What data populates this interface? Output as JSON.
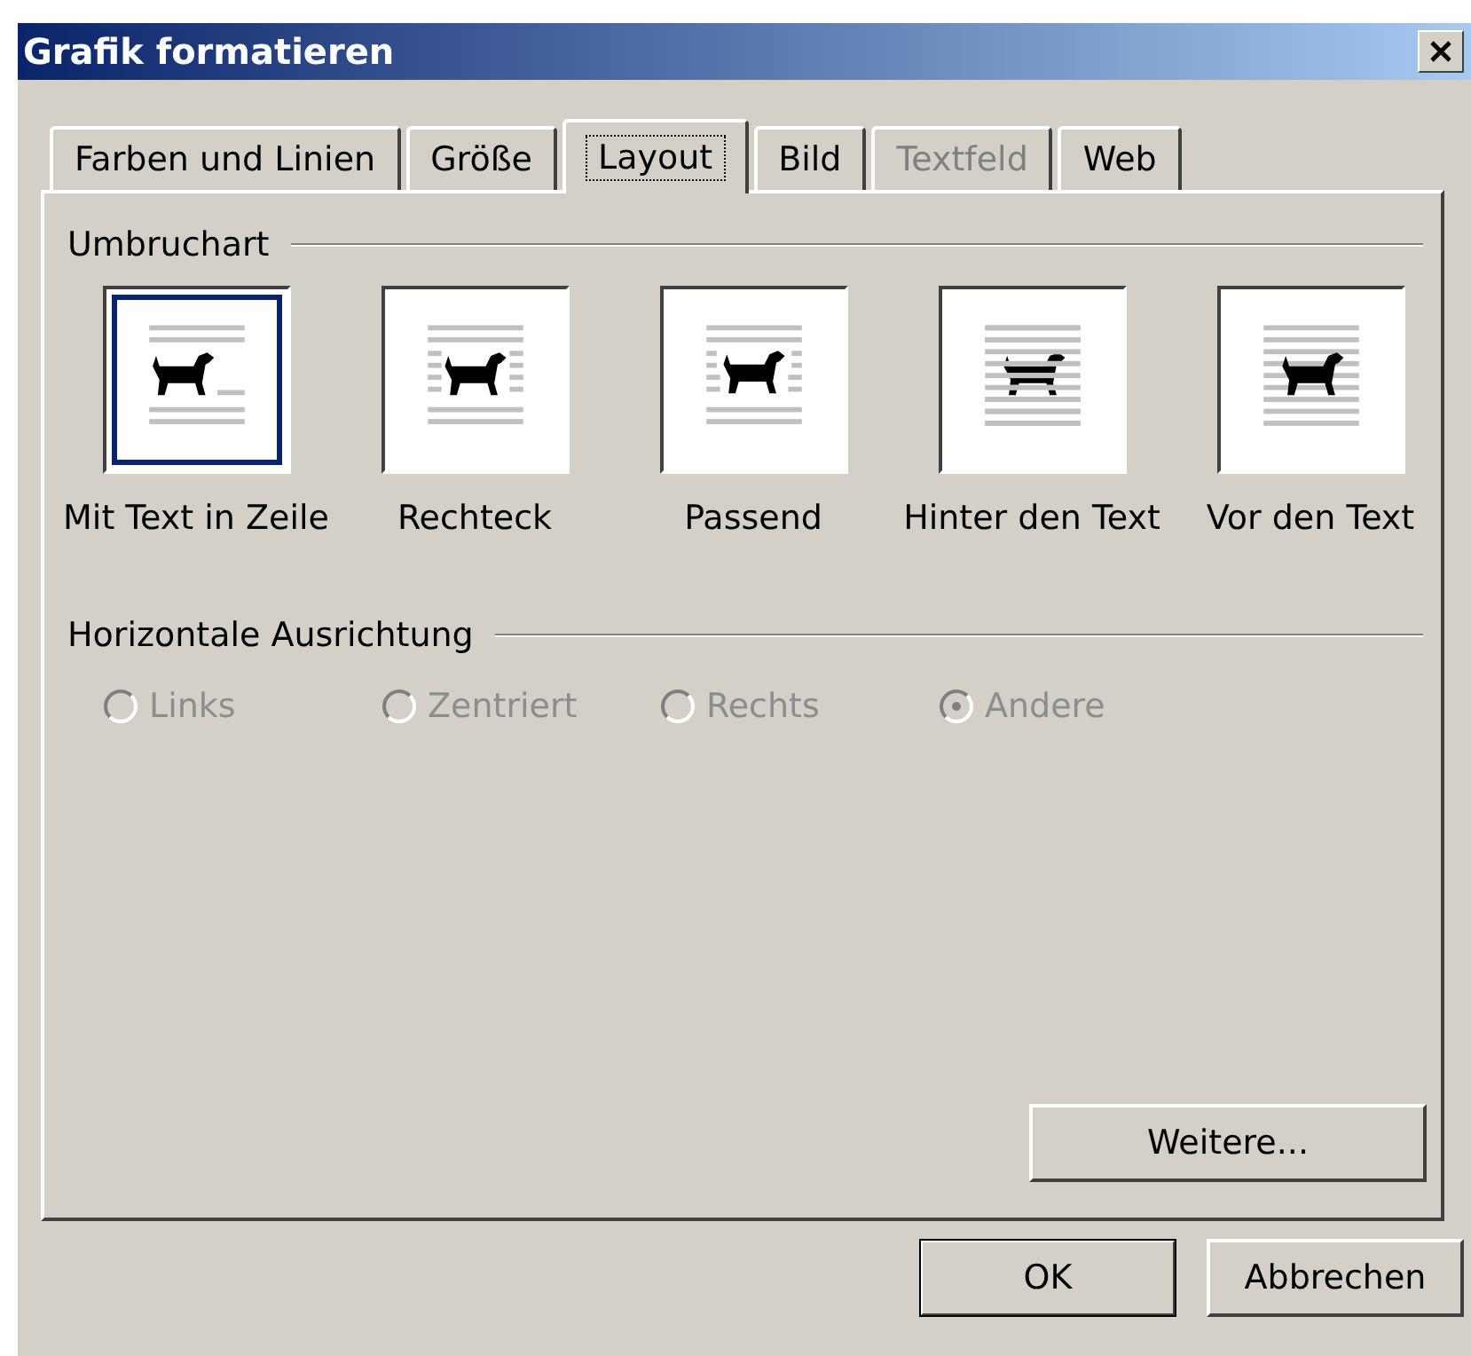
{
  "window": {
    "title": "Grafik formatieren"
  },
  "tabs": [
    {
      "label": "Farben und Linien",
      "selected": false,
      "disabled": false
    },
    {
      "label": "Größe",
      "selected": false,
      "disabled": false
    },
    {
      "label": "Layout",
      "selected": true,
      "disabled": false
    },
    {
      "label": "Bild",
      "selected": false,
      "disabled": false
    },
    {
      "label": "Textfeld",
      "selected": false,
      "disabled": true
    },
    {
      "label": "Web",
      "selected": false,
      "disabled": false
    }
  ],
  "wrap_style": {
    "heading": "Umbruchart",
    "options": [
      {
        "label": "Mit Text in Zeile",
        "kind": "inline",
        "selected": true
      },
      {
        "label": "Rechteck",
        "kind": "square",
        "selected": false
      },
      {
        "label": "Passend",
        "kind": "tight",
        "selected": false
      },
      {
        "label": "Hinter den Text",
        "kind": "behind",
        "selected": false
      },
      {
        "label": "Vor den Text",
        "kind": "front",
        "selected": false
      }
    ]
  },
  "horizontal_alignment": {
    "heading": "Horizontale Ausrichtung",
    "options": [
      {
        "label": "Links",
        "checked": false,
        "disabled": true
      },
      {
        "label": "Zentriert",
        "checked": false,
        "disabled": true
      },
      {
        "label": "Rechts",
        "checked": false,
        "disabled": true
      },
      {
        "label": "Andere",
        "checked": true,
        "disabled": true
      }
    ]
  },
  "more_button": "Weitere...",
  "buttons": [
    {
      "label": "OK",
      "default": true
    },
    {
      "label": "Abbrechen",
      "default": false
    }
  ]
}
